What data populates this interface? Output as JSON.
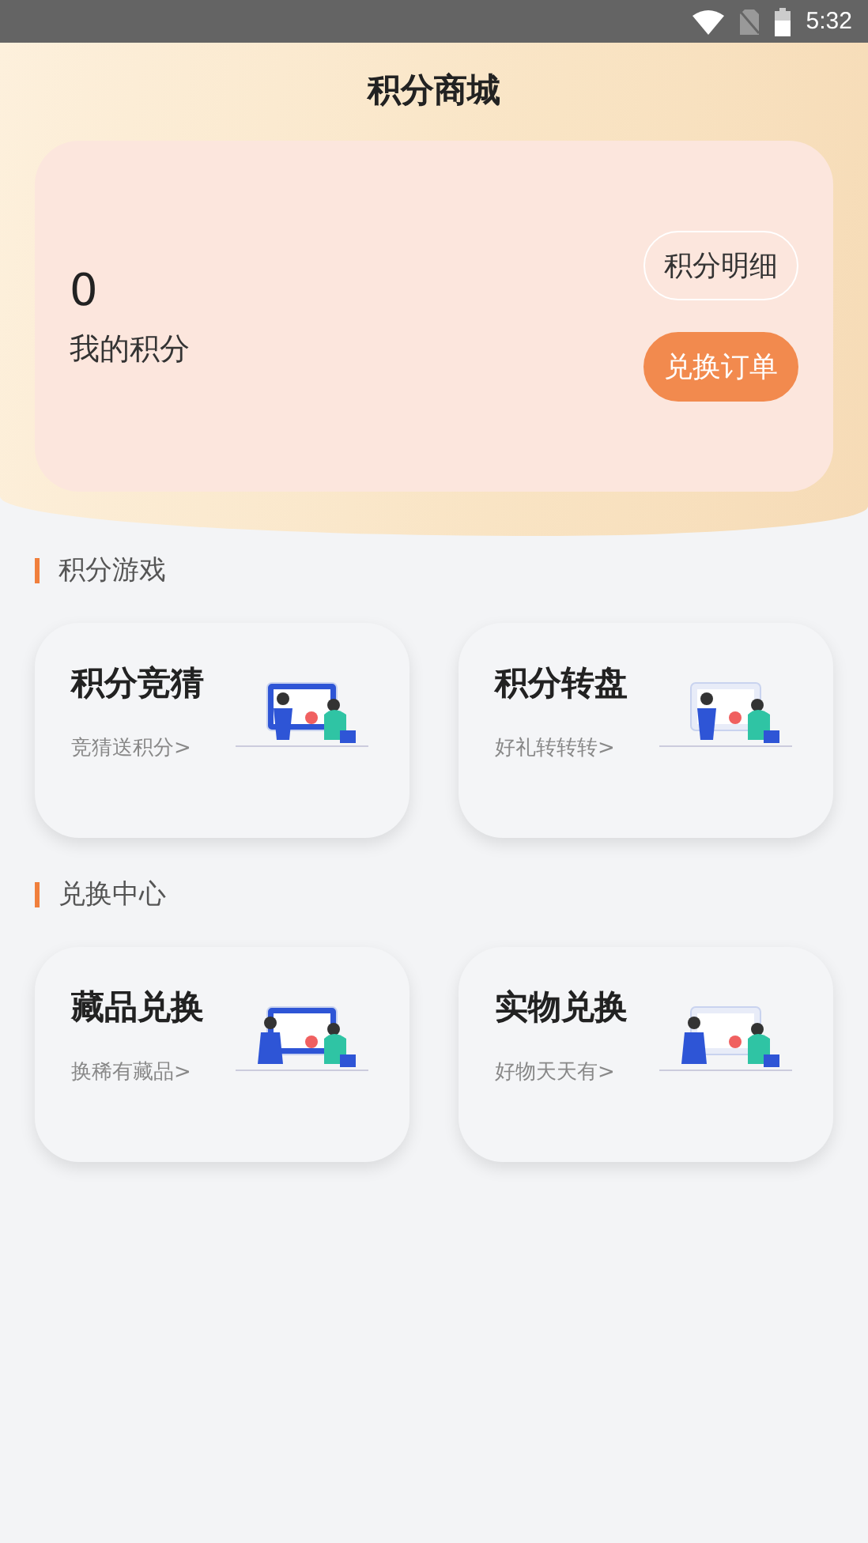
{
  "status_bar": {
    "time": "5:32"
  },
  "header": {
    "title": "积分商城"
  },
  "points_card": {
    "value": "0",
    "label": "我的积分",
    "buttons": [
      {
        "label": "积分明细",
        "kind": "outline"
      },
      {
        "label": "兑换订单",
        "kind": "filled"
      }
    ]
  },
  "sections": [
    {
      "title": "积分游戏",
      "cards": [
        {
          "title": "积分竞猜",
          "subtitle": "竞猜送积分>"
        },
        {
          "title": "积分转盘",
          "subtitle": "好礼转转转>"
        }
      ]
    },
    {
      "title": "兑换中心",
      "cards": [
        {
          "title": "藏品兑换",
          "subtitle": "换稀有藏品>"
        },
        {
          "title": "实物兑换",
          "subtitle": "好物天天有>"
        }
      ]
    }
  ]
}
